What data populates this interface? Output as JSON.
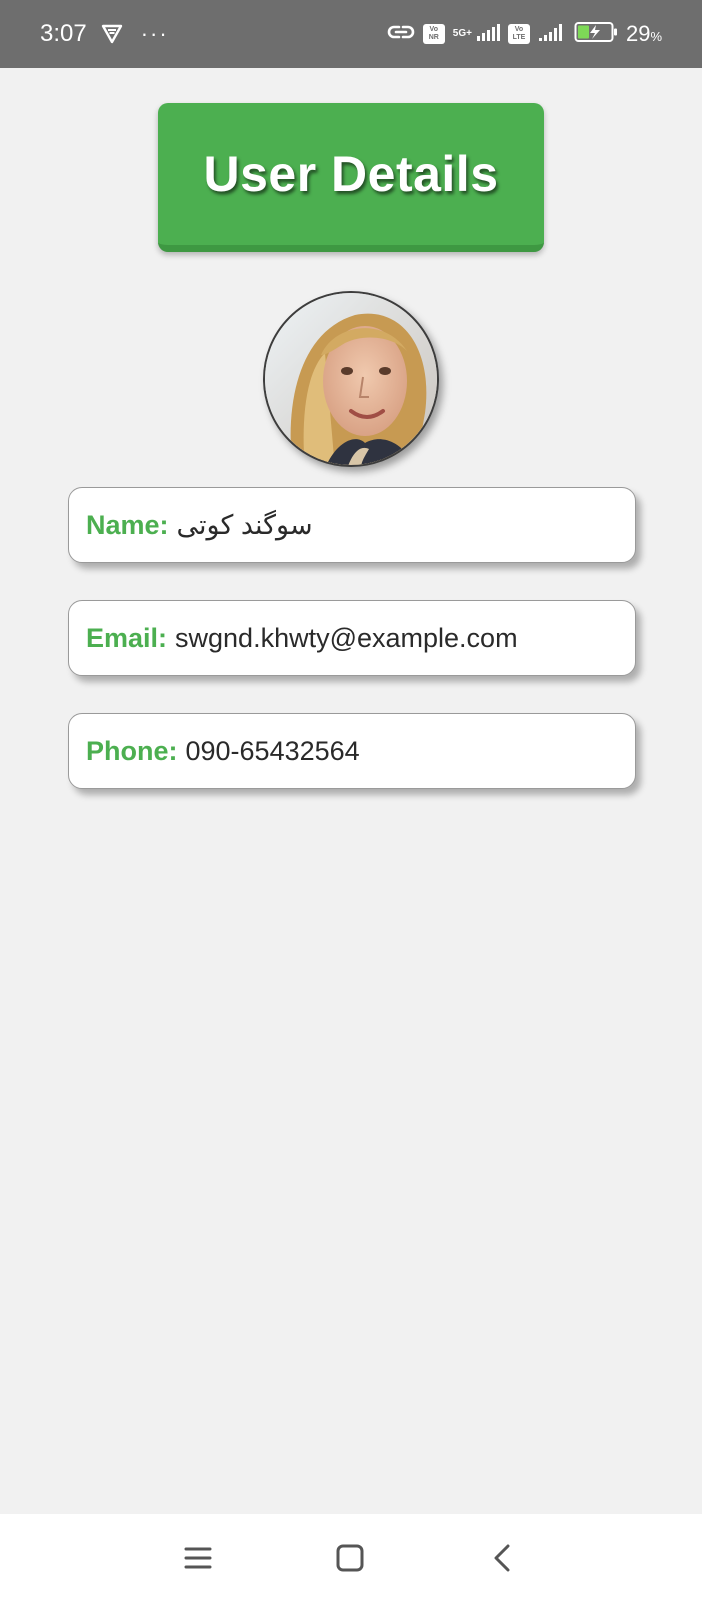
{
  "status_bar": {
    "time": "3:07",
    "dots": "···",
    "battery_level": "29",
    "battery_unit": "%",
    "volte_badge_1": [
      "Vo",
      "NR"
    ],
    "volte_badge_2": [
      "Vo",
      "LTE"
    ],
    "network_label": "5G+",
    "icons": [
      "vpn-shield-icon",
      "link-icon",
      "signal-icon",
      "battery-charging-icon"
    ]
  },
  "header": {
    "title": "User Details"
  },
  "profile": {
    "avatar_alt": "user-photo"
  },
  "fields": {
    "name": {
      "label": "Name:",
      "value": "سوگند کوتی"
    },
    "email": {
      "label": "Email:",
      "value": "swgnd.khwty@example.com"
    },
    "phone": {
      "label": "Phone:",
      "value": "090-65432564"
    }
  },
  "nav_bar": {
    "icons": [
      "menu-icon",
      "home-icon",
      "back-icon"
    ]
  },
  "colors": {
    "accent": "#4caf50",
    "status_bar": "#6e6e6e",
    "background": "#f1f1f1"
  }
}
